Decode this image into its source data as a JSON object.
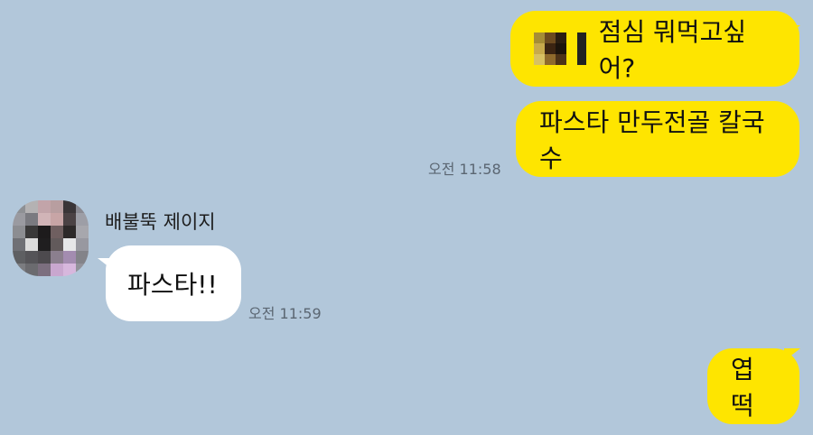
{
  "messages": {
    "m1": {
      "text": "점심 뭐먹고싶어?"
    },
    "m2": {
      "text": "파스타 만두전골 칼국수",
      "time": "오전 11:58"
    },
    "m3": {
      "sender": "배불뚝 제이지",
      "text": "파스타!!",
      "time": "오전 11:59"
    },
    "m4": {
      "text": "엽떡"
    }
  },
  "colors": {
    "background": "#b2c7da",
    "my_bubble": "#fee500",
    "their_bubble": "#ffffff"
  },
  "icons": [
    "censored-mosaic-icon",
    "profile-avatar"
  ]
}
